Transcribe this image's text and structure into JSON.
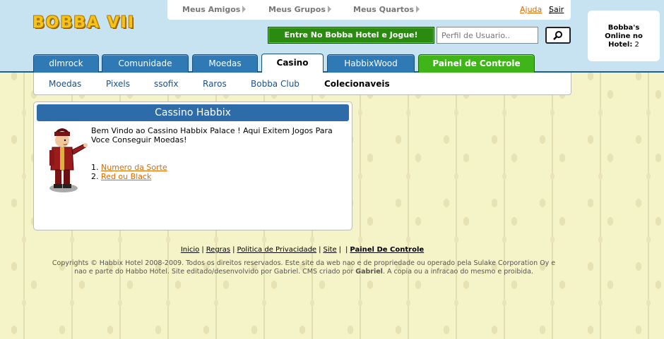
{
  "logo": {
    "text": "BOBBA VII"
  },
  "topnav": {
    "friends": "Meus Amigos",
    "groups": "Meus Grupos",
    "rooms": "Meus Quartos"
  },
  "util": {
    "help": "Ajuda",
    "logout": "Sair"
  },
  "play_button": "Entre No Bobba Hotel e Jogue!",
  "search": {
    "placeholder": "Perfil de Usuario.."
  },
  "online": {
    "line1": "Bobba's",
    "line2": "Online no",
    "line3_label": "Hotel:",
    "count": "2"
  },
  "tabs": [
    {
      "label": "dlmrock"
    },
    {
      "label": "Comunidade"
    },
    {
      "label": "Moedas"
    },
    {
      "label": "Casino"
    },
    {
      "label": "HabbixWood"
    },
    {
      "label": "Painel de Controle"
    }
  ],
  "subnav": [
    "Moedas",
    "Pixels",
    "ssofix",
    "Raros",
    "Bobba Club",
    "Colecionaveis"
  ],
  "main": {
    "title": "Cassino Habbix",
    "welcome": "Bem Vindo ao Cassino Habbix Palace ! Aqui Exitem Jogos Para Voce Conseguir Moedas!",
    "games": [
      "Numero da Sorte",
      "Red ou Black"
    ]
  },
  "footer": {
    "links": [
      "Inicio",
      "Regras",
      "Politica de Privacidade",
      "Site",
      "Painel De Controle"
    ],
    "copyright_line1": "Copyrights © Habbix Hotel 2008-2009. Todos os direitos reservados. Este site da web nao e de propriedade ou operado pela Sulake Corporation Oy e",
    "copyright_line2_a": "nao e parte do Habbo Hotel. Site editado/desenvolvido por Gabriel. CMS criado por ",
    "copyright_author": "Gabriel",
    "copyright_line2_b": ". A copia ou a infracao do mesmo e proibida."
  },
  "colors": {
    "header_bg": "#c7e3f1",
    "tab_blue": "#2f79b5",
    "tab_green": "#3fb51a",
    "title_bar": "#2d6ba9",
    "link_orange": "#e06a00"
  }
}
